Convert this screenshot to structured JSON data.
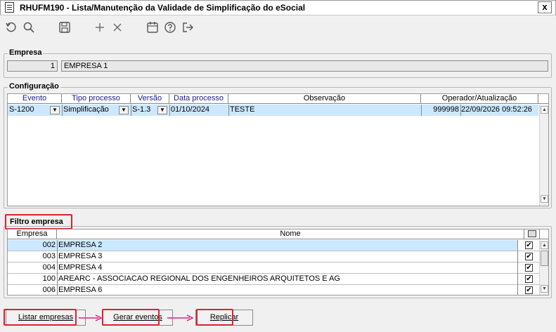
{
  "window": {
    "title": "RHUFM190 - Lista/Manutenção da Validade de Simplificação do eSocial",
    "close_label": "x"
  },
  "toolbar": {
    "icons": [
      "undo-icon",
      "search-icon",
      "save-icon",
      "add-icon",
      "delete-icon",
      "calendar-icon",
      "help-icon",
      "exit-icon"
    ]
  },
  "empresa": {
    "group_label": "Empresa",
    "code": "1",
    "name": "EMPRESA 1"
  },
  "configuracao": {
    "group_label": "Configuração",
    "columns": [
      "Evento",
      "Tipo processo",
      "Versão",
      "Data processo",
      "Observação",
      "Operador/Atualização"
    ],
    "rows": [
      {
        "evento": "S-1200",
        "tipo": "Simplificação",
        "versao": "S-1.3",
        "data": "01/10/2024",
        "obs": "TESTE",
        "operador": "999998",
        "atualizacao": "22/09/2026 09:52:26"
      }
    ]
  },
  "filtro": {
    "group_label": "Filtro empresa",
    "columns": [
      "Empresa",
      "Nome"
    ],
    "rows": [
      {
        "codigo": "002",
        "nome": "EMPRESA 2",
        "checked": true
      },
      {
        "codigo": "003",
        "nome": "EMPRESA 3",
        "checked": true
      },
      {
        "codigo": "004",
        "nome": "EMPRESA 4",
        "checked": true
      },
      {
        "codigo": "100",
        "nome": "AREARC - ASSOCIACAO REGIONAL DOS ENGENHEIROS ARQUITETOS E AG",
        "checked": true
      },
      {
        "codigo": "006",
        "nome": "EMPRESA 6",
        "checked": true
      }
    ]
  },
  "actions": {
    "listar": "Listar empresas",
    "gerar": "Gerar eventos",
    "replicar": "Replicar"
  },
  "colors": {
    "selected_row": "#cce8ff",
    "highlight": "#e02030",
    "header_text": "#1a1a8c"
  }
}
